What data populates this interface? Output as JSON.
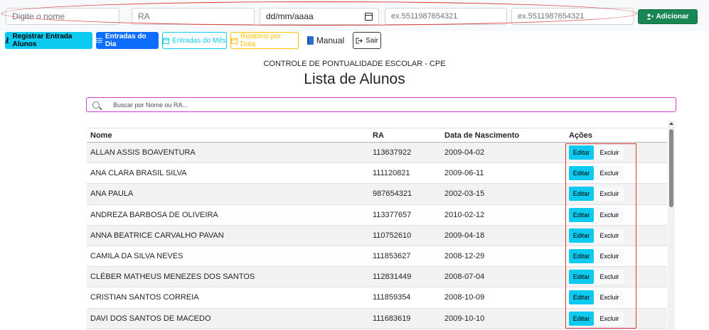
{
  "form": {
    "name_placeholder": "Digite o nome",
    "ra_placeholder": "RA",
    "date_placeholder": "dd/mm/aaaa",
    "phone1_placeholder": "ex.5511987654321",
    "phone2_placeholder": "ex.5511987654321",
    "add_label": "Adicionar",
    "add_icon": "person-plus-icon"
  },
  "nav": {
    "register": "Registrar Entrada Alunos",
    "today": "Entradas do Dia",
    "month": "Entradas do Mês",
    "report": "Relatório por Data",
    "manual": "Manual",
    "exit": "Sair"
  },
  "header": {
    "subtitle": "CONTROLE DE PONTUALIDADE ESCOLAR - CPE",
    "title": "Lista de Alunos"
  },
  "search": {
    "placeholder": "Buscar por Nome ou RA..."
  },
  "table": {
    "columns": [
      "Nome",
      "RA",
      "Data de Nascimento",
      "Ações"
    ],
    "edit_label": "Editar",
    "delete_label": "Excluir",
    "rows": [
      {
        "name": "ALLAN ASSIS BOAVENTURA",
        "ra": "113637922",
        "dob": "2009-04-02"
      },
      {
        "name": "ANA CLARA BRASIL SILVA",
        "ra": "111120821",
        "dob": "2009-06-11"
      },
      {
        "name": "ANA PAULA",
        "ra": "987654321",
        "dob": "2002-03-15"
      },
      {
        "name": "ANDREZA BARBOSA DE OLIVEIRA",
        "ra": "113377657",
        "dob": "2010-02-12"
      },
      {
        "name": "ANNA BEATRICE CARVALHO PAVAN",
        "ra": "110752610",
        "dob": "2009-04-18"
      },
      {
        "name": "CAMILA DA SILVA NEVES",
        "ra": "111853627",
        "dob": "2008-12-29"
      },
      {
        "name": "CLÉBER MATHEUS MENEZES DOS SANTOS",
        "ra": "112831449",
        "dob": "2008-07-04"
      },
      {
        "name": "CRISTIAN SANTOS CORREIA",
        "ra": "111859354",
        "dob": "2008-10-09"
      },
      {
        "name": "DAVI DOS SANTOS DE MACEDO",
        "ra": "111683619",
        "dob": "2009-10-10"
      }
    ]
  },
  "colors": {
    "success": "#198754",
    "primary": "#0d6efd",
    "info": "#0dcaf0",
    "warning": "#ffc107",
    "annotation": "#d93a3a"
  }
}
